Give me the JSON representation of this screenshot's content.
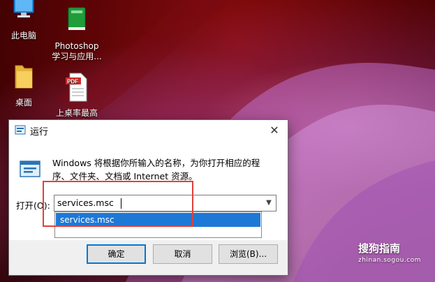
{
  "desktop": {
    "icons": [
      {
        "label": "此电脑",
        "kind": "computer-icon"
      },
      {
        "label": "Photoshop\n学习与应用...",
        "kind": "book-icon"
      },
      {
        "label": "桌面",
        "kind": "folder-icon"
      },
      {
        "label": "上桌率最高\n的家常菜...",
        "kind": "pdf-icon"
      }
    ]
  },
  "run_dialog": {
    "title": "运行",
    "close_symbol": "✕",
    "description": "Windows 将根据你所输入的名称，为你打开相应的程序、文件夹、文档或 Internet 资源。",
    "open_label": "打开(O):",
    "input_value": "services.msc",
    "suggestion": "services.msc",
    "buttons": {
      "ok": "确定",
      "cancel": "取消",
      "browse": "浏览(B)..."
    }
  },
  "watermark": {
    "brand": "搜狗指南",
    "url": "zhinan.sogou.com"
  },
  "colors": {
    "selection": "#1e79d6",
    "highlight_box": "#e0403a",
    "ok_border": "#0078d7"
  }
}
